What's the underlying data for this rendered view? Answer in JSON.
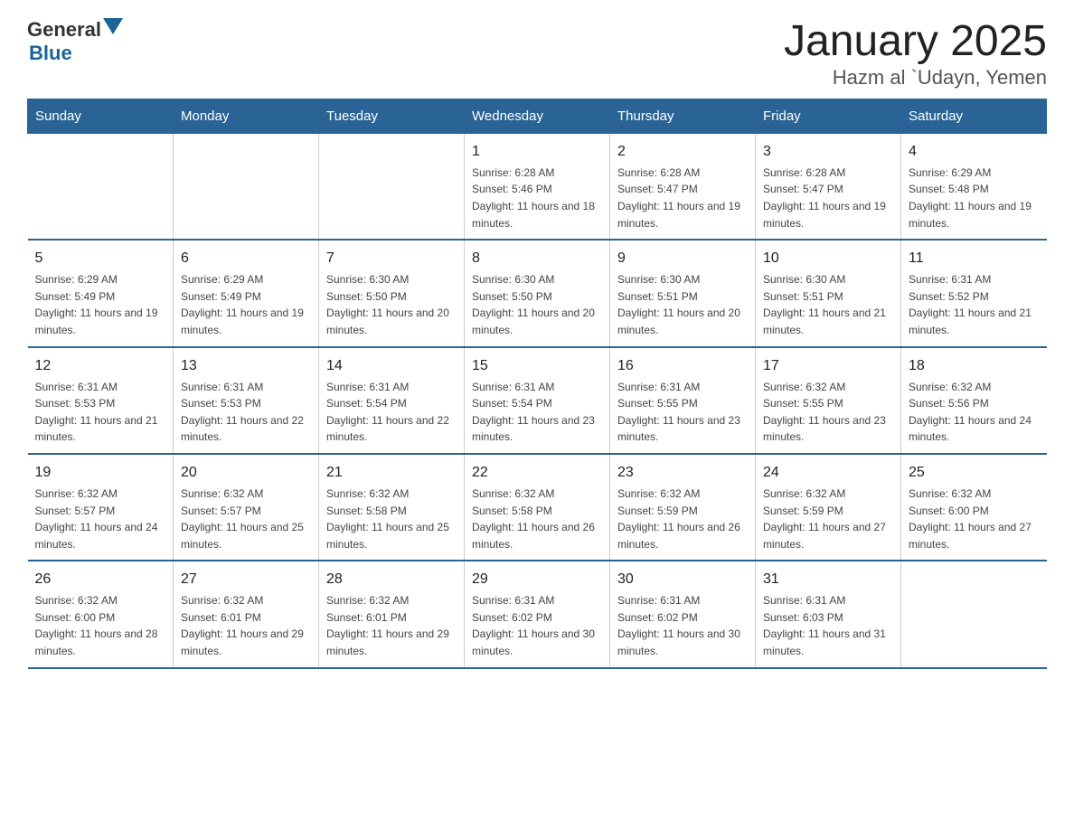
{
  "logo": {
    "general": "General",
    "blue": "Blue"
  },
  "title": "January 2025",
  "subtitle": "Hazm al `Udayn, Yemen",
  "days": [
    "Sunday",
    "Monday",
    "Tuesday",
    "Wednesday",
    "Thursday",
    "Friday",
    "Saturday"
  ],
  "weeks": [
    [
      {
        "day": "",
        "info": ""
      },
      {
        "day": "",
        "info": ""
      },
      {
        "day": "",
        "info": ""
      },
      {
        "day": "1",
        "info": "Sunrise: 6:28 AM\nSunset: 5:46 PM\nDaylight: 11 hours and 18 minutes."
      },
      {
        "day": "2",
        "info": "Sunrise: 6:28 AM\nSunset: 5:47 PM\nDaylight: 11 hours and 19 minutes."
      },
      {
        "day": "3",
        "info": "Sunrise: 6:28 AM\nSunset: 5:47 PM\nDaylight: 11 hours and 19 minutes."
      },
      {
        "day": "4",
        "info": "Sunrise: 6:29 AM\nSunset: 5:48 PM\nDaylight: 11 hours and 19 minutes."
      }
    ],
    [
      {
        "day": "5",
        "info": "Sunrise: 6:29 AM\nSunset: 5:49 PM\nDaylight: 11 hours and 19 minutes."
      },
      {
        "day": "6",
        "info": "Sunrise: 6:29 AM\nSunset: 5:49 PM\nDaylight: 11 hours and 19 minutes."
      },
      {
        "day": "7",
        "info": "Sunrise: 6:30 AM\nSunset: 5:50 PM\nDaylight: 11 hours and 20 minutes."
      },
      {
        "day": "8",
        "info": "Sunrise: 6:30 AM\nSunset: 5:50 PM\nDaylight: 11 hours and 20 minutes."
      },
      {
        "day": "9",
        "info": "Sunrise: 6:30 AM\nSunset: 5:51 PM\nDaylight: 11 hours and 20 minutes."
      },
      {
        "day": "10",
        "info": "Sunrise: 6:30 AM\nSunset: 5:51 PM\nDaylight: 11 hours and 21 minutes."
      },
      {
        "day": "11",
        "info": "Sunrise: 6:31 AM\nSunset: 5:52 PM\nDaylight: 11 hours and 21 minutes."
      }
    ],
    [
      {
        "day": "12",
        "info": "Sunrise: 6:31 AM\nSunset: 5:53 PM\nDaylight: 11 hours and 21 minutes."
      },
      {
        "day": "13",
        "info": "Sunrise: 6:31 AM\nSunset: 5:53 PM\nDaylight: 11 hours and 22 minutes."
      },
      {
        "day": "14",
        "info": "Sunrise: 6:31 AM\nSunset: 5:54 PM\nDaylight: 11 hours and 22 minutes."
      },
      {
        "day": "15",
        "info": "Sunrise: 6:31 AM\nSunset: 5:54 PM\nDaylight: 11 hours and 23 minutes."
      },
      {
        "day": "16",
        "info": "Sunrise: 6:31 AM\nSunset: 5:55 PM\nDaylight: 11 hours and 23 minutes."
      },
      {
        "day": "17",
        "info": "Sunrise: 6:32 AM\nSunset: 5:55 PM\nDaylight: 11 hours and 23 minutes."
      },
      {
        "day": "18",
        "info": "Sunrise: 6:32 AM\nSunset: 5:56 PM\nDaylight: 11 hours and 24 minutes."
      }
    ],
    [
      {
        "day": "19",
        "info": "Sunrise: 6:32 AM\nSunset: 5:57 PM\nDaylight: 11 hours and 24 minutes."
      },
      {
        "day": "20",
        "info": "Sunrise: 6:32 AM\nSunset: 5:57 PM\nDaylight: 11 hours and 25 minutes."
      },
      {
        "day": "21",
        "info": "Sunrise: 6:32 AM\nSunset: 5:58 PM\nDaylight: 11 hours and 25 minutes."
      },
      {
        "day": "22",
        "info": "Sunrise: 6:32 AM\nSunset: 5:58 PM\nDaylight: 11 hours and 26 minutes."
      },
      {
        "day": "23",
        "info": "Sunrise: 6:32 AM\nSunset: 5:59 PM\nDaylight: 11 hours and 26 minutes."
      },
      {
        "day": "24",
        "info": "Sunrise: 6:32 AM\nSunset: 5:59 PM\nDaylight: 11 hours and 27 minutes."
      },
      {
        "day": "25",
        "info": "Sunrise: 6:32 AM\nSunset: 6:00 PM\nDaylight: 11 hours and 27 minutes."
      }
    ],
    [
      {
        "day": "26",
        "info": "Sunrise: 6:32 AM\nSunset: 6:00 PM\nDaylight: 11 hours and 28 minutes."
      },
      {
        "day": "27",
        "info": "Sunrise: 6:32 AM\nSunset: 6:01 PM\nDaylight: 11 hours and 29 minutes."
      },
      {
        "day": "28",
        "info": "Sunrise: 6:32 AM\nSunset: 6:01 PM\nDaylight: 11 hours and 29 minutes."
      },
      {
        "day": "29",
        "info": "Sunrise: 6:31 AM\nSunset: 6:02 PM\nDaylight: 11 hours and 30 minutes."
      },
      {
        "day": "30",
        "info": "Sunrise: 6:31 AM\nSunset: 6:02 PM\nDaylight: 11 hours and 30 minutes."
      },
      {
        "day": "31",
        "info": "Sunrise: 6:31 AM\nSunset: 6:03 PM\nDaylight: 11 hours and 31 minutes."
      },
      {
        "day": "",
        "info": ""
      }
    ]
  ]
}
